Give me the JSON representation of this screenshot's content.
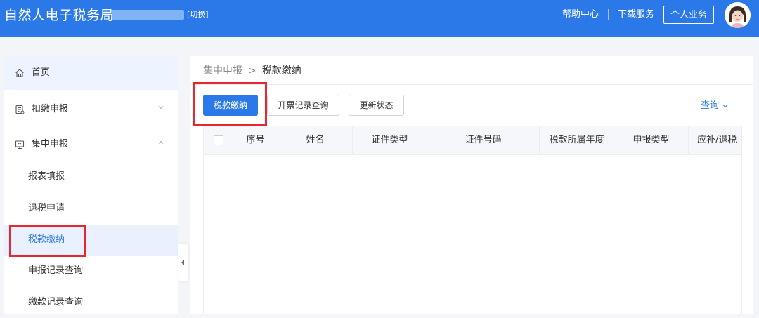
{
  "header": {
    "app_title": "自然人电子税务局",
    "switch_label": "[切换]",
    "help_label": "帮助中心",
    "download_label": "下载服务",
    "personal_button": "个人业务"
  },
  "sidebar": {
    "items": [
      {
        "label": "首页"
      },
      {
        "label": "扣缴申报"
      },
      {
        "label": "集中申报"
      }
    ],
    "sub_items": [
      {
        "label": "报表填报"
      },
      {
        "label": "退税申请"
      },
      {
        "label": "税款缴纳"
      },
      {
        "label": "申报记录查询"
      },
      {
        "label": "缴款记录查询"
      }
    ]
  },
  "breadcrumb": {
    "parent": "集中申报",
    "separator": ">",
    "current": "税款缴纳"
  },
  "toolbar": {
    "pay_button": "税款缴纳",
    "invoice_button": "开票记录查询",
    "refresh_button": "更新状态",
    "query_link": "查询"
  },
  "table": {
    "columns": [
      "序号",
      "姓名",
      "证件类型",
      "证件号码",
      "税款所属年度",
      "申报类型",
      "应补/退税"
    ]
  },
  "colors": {
    "primary": "#2b79e8",
    "highlight_box": "#e8262e"
  }
}
